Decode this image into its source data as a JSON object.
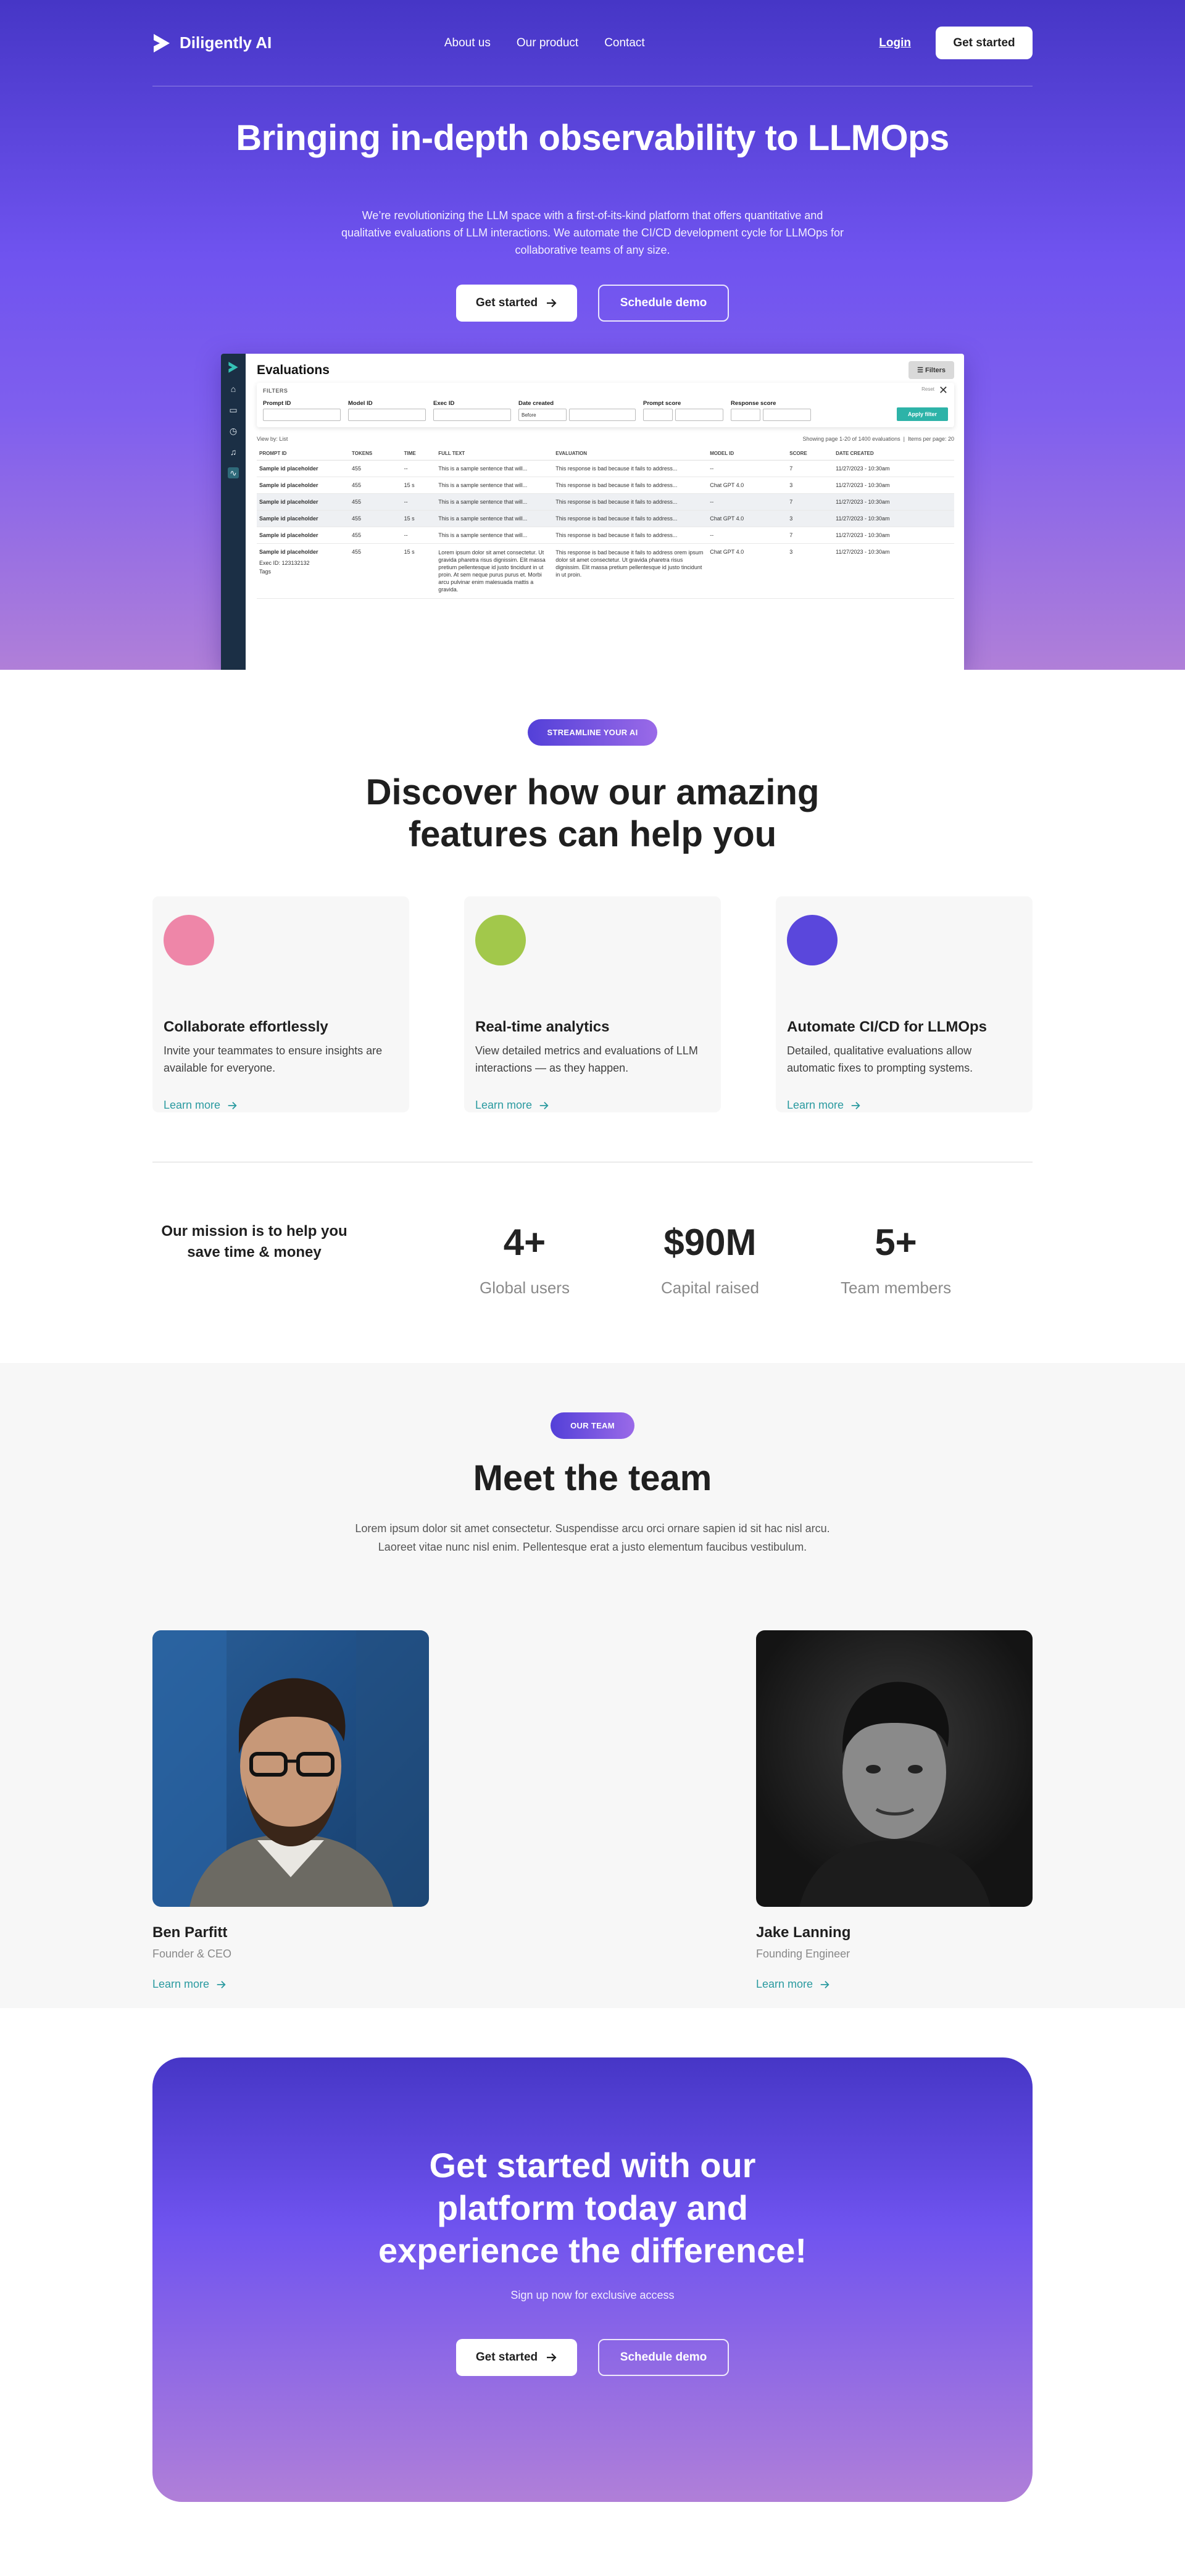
{
  "nav": {
    "brand": "Diligently AI",
    "links": [
      "About us",
      "Our product",
      "Contact"
    ],
    "login": "Login",
    "cta": "Get started"
  },
  "hero": {
    "title": "Bringing in-depth observability to LLMOps",
    "lead": "We’re revolutionizing the LLM space with a first-of-its-kind platform that offers quantitative and qualitative evaluations of LLM interactions. We automate the CI/CD development cycle for LLMOps for collaborative teams of any size.",
    "primary": "Get started",
    "secondary": "Schedule demo"
  },
  "app": {
    "title": "Evaluations",
    "filters_button": "Filters",
    "filters_label": "FILTERS",
    "reset": "Reset",
    "fields": {
      "prompt_id": "Prompt ID",
      "model_id": "Model ID",
      "exec_id": "Exec ID",
      "date_created": "Date created",
      "prompt_score": "Prompt score",
      "response_score": "Response score"
    },
    "date_mode": "Before",
    "apply": "Apply filter",
    "view_by": "View by: List",
    "paging": "Showing page 1-20 of 1400 evaluations",
    "items_per_page": "Items per page: 20",
    "columns": [
      "PROMPT ID",
      "TOKENS",
      "TIME",
      "FULL TEXT",
      "EVALUATION",
      "MODEL ID",
      "SCORE",
      "DATE CREATED"
    ],
    "rows": [
      {
        "id": "Sample id placeholder",
        "tokens": "455",
        "time": "--",
        "text": "This is a sample sentence that will...",
        "eval": "This response is bad because it fails to address...",
        "model": "--",
        "score": "7",
        "date": "11/27/2023 - 10:30am"
      },
      {
        "id": "Sample id placeholder",
        "tokens": "455",
        "time": "15 s",
        "text": "This is a sample sentence that will...",
        "eval": "This response is bad because it fails to address...",
        "model": "Chat GPT 4.0",
        "score": "3",
        "date": "11/27/2023 - 10:30am"
      },
      {
        "id": "Sample id placeholder",
        "tokens": "455",
        "time": "--",
        "text": "This is a sample sentence that will...",
        "eval": "This response is bad because it fails to address...",
        "model": "--",
        "score": "7",
        "date": "11/27/2023 - 10:30am"
      },
      {
        "id": "Sample id placeholder",
        "tokens": "455",
        "time": "15 s",
        "text": "This is a sample sentence that will...",
        "eval": "This response is bad because it fails to address...",
        "model": "Chat GPT 4.0",
        "score": "3",
        "date": "11/27/2023 - 10:30am"
      },
      {
        "id": "Sample id placeholder",
        "tokens": "455",
        "time": "--",
        "text": "This is a sample sentence that will...",
        "eval": "This response is bad because it fails to address...",
        "model": "--",
        "score": "7",
        "date": "11/27/2023 - 10:30am"
      }
    ],
    "expanded": {
      "id": "Sample id placeholder",
      "tokens": "455",
      "time": "15 s",
      "text": "Lorem ipsum dolor sit amet consectetur. Ut gravida pharetra risus dignissim. Elit massa pretium pellentesque id justo tincidunt in ut proin. At sem neque purus purus et. Morbi arcu pulvinar enim malesuada mattis a gravida.",
      "eval": "This response is bad because it fails to address orem ipsum dolor sit amet consectetur. Ut gravida pharetra risus dignissim. Elit massa pretium pellentesque id justo tincidunt in ut proin.",
      "model": "Chat GPT 4.0",
      "score": "3",
      "date": "11/27/2023 - 10:30am",
      "exec": "Exec ID: 123132132",
      "tags": "Tags"
    }
  },
  "features": {
    "pill": "STREAMLINE YOUR AI",
    "title_line1": "Discover how our amazing",
    "title_line2": "features can help you",
    "cards": [
      {
        "title": "Collaborate effortlessly",
        "text": "Invite your teammates to ensure insights are available for everyone.",
        "link": "Learn more",
        "color": "#ee86a8"
      },
      {
        "title": "Real-time analytics",
        "text": "View detailed metrics and evaluations of LLM interactions — as they happen.",
        "link": "Learn more",
        "color": "#a2c84b"
      },
      {
        "title": "Automate CI/CD for LLMOps",
        "text": "Detailed, qualitative evaluations allow automatic fixes to prompting systems.",
        "link": "Learn more",
        "color": "#5a47dc"
      }
    ]
  },
  "stats": {
    "mission": "Our mission is to help you save time & money",
    "items": [
      {
        "num": "4+",
        "label": "Global users"
      },
      {
        "num": "$90M",
        "label": "Capital raised"
      },
      {
        "num": "5+",
        "label": "Team members"
      }
    ]
  },
  "team": {
    "pill": "OUR TEAM",
    "title": "Meet the team",
    "sub": "Lorem ipsum dolor sit amet consectetur. Suspendisse arcu orci ornare sapien id sit hac nisl arcu. Laoreet vitae nunc nisl enim. Pellentesque erat a justo elementum faucibus vestibulum.",
    "members": [
      {
        "name": "Ben Parfitt",
        "role": "Founder & CEO",
        "link": "Learn more"
      },
      {
        "name": "Jake Lanning",
        "role": "Founding Engineer",
        "link": "Learn more"
      }
    ]
  },
  "cta": {
    "title": "Get started with our platform today and experience the difference!",
    "sub": "Sign up now for exclusive access",
    "primary": "Get started",
    "secondary": "Schedule demo"
  },
  "colors": {
    "accent": "#6f53ef",
    "teal": "#2a9aa0",
    "brand_dark": "#4636c6"
  }
}
